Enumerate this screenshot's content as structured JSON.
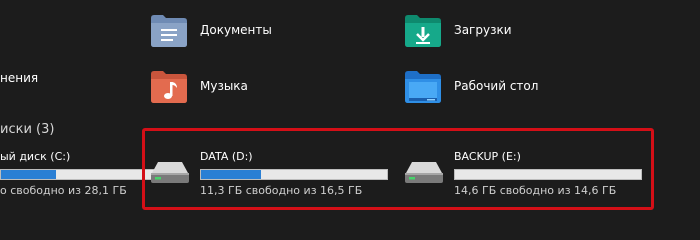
{
  "folders": [
    {
      "label": "Документы",
      "icon": "documents-folder-icon"
    },
    {
      "label": "Загрузки",
      "icon": "downloads-folder-icon"
    },
    {
      "label": "Музыка",
      "icon": "music-folder-icon"
    },
    {
      "label": "Рабочий стол",
      "icon": "desktop-folder-icon"
    }
  ],
  "left_partial_label": "нения",
  "devices_section": {
    "title": "иски (3)"
  },
  "drives": [
    {
      "name": "ый диск (C:)",
      "free_text": "о свободно из 28,1 ГБ",
      "used_fraction": 0.3
    },
    {
      "name": "DATA (D:)",
      "free_text": "11,3 ГБ свободно из 16,5 ГБ",
      "used_fraction": 0.32
    },
    {
      "name": "BACKUP (E:)",
      "free_text": "14,6 ГБ свободно из 14,6 ГБ",
      "used_fraction": 0.0
    }
  ],
  "colors": {
    "background": "#1c1c1c",
    "bar_fill": "#2a7fd4",
    "bar_track": "#e8e8e8",
    "highlight_border": "#d40f17"
  }
}
